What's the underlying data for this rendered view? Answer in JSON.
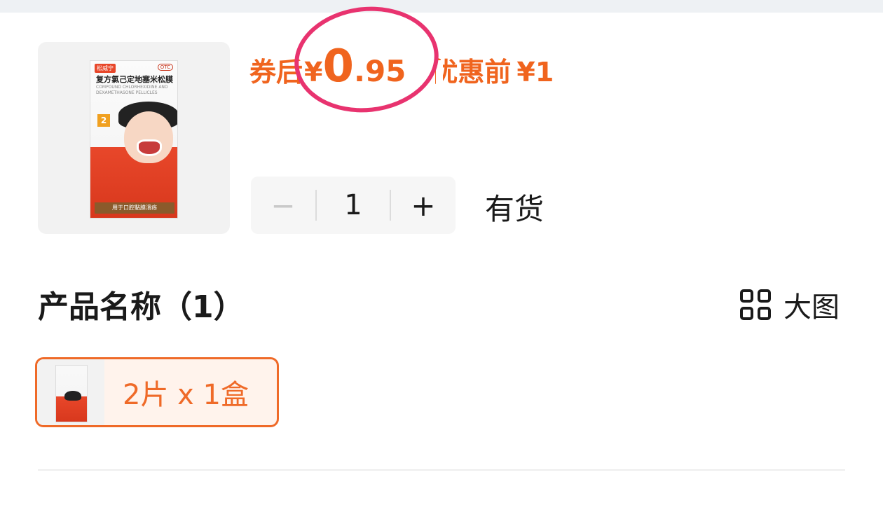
{
  "product": {
    "box_brand": "松威宁",
    "box_otc": "OTC",
    "box_name_cn": "复方氯己定地塞米松膜",
    "box_name_en": "COMPOUND CHLORHEXIDINE AND DEXAMETHASONE PELLICLES",
    "box_qty": "2",
    "box_band": "用于口腔黏膜溃疡"
  },
  "price": {
    "label": "券后",
    "currency": "¥",
    "integer": "0",
    "decimal": ".95",
    "before_label": "优惠前",
    "before_value": "¥1",
    "accent_color": "#f0641e",
    "annotation_color": "#e8336f"
  },
  "stepper": {
    "minus": "−",
    "value": "1",
    "plus": "+"
  },
  "stock_status": "有货",
  "section": {
    "title": "产品名称（1）",
    "view_toggle_icon": "grid-icon",
    "view_toggle_label": "大图"
  },
  "options": [
    {
      "label": "2片 x 1盒",
      "selected": true
    }
  ]
}
